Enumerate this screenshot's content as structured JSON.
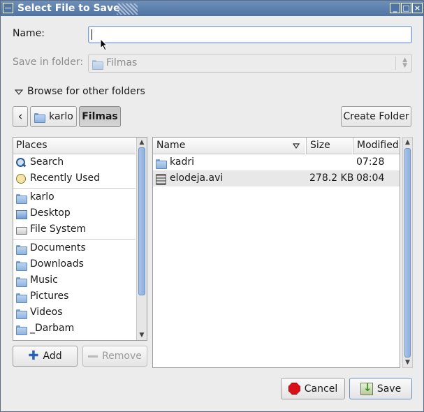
{
  "window": {
    "title": "Select File to Save",
    "controls": [
      "_",
      "□",
      "×"
    ]
  },
  "form": {
    "name_label": "Name:",
    "name_value": "",
    "save_in_label": "Save in folder:",
    "save_in_value": "Filmas",
    "browse_label": "Browse for other folders"
  },
  "path_bar": {
    "back_glyph": "‹",
    "segments": [
      {
        "label": "karlo",
        "icon": "home-icon"
      },
      {
        "label": "Filmas",
        "icon": "folder-icon",
        "active": true
      }
    ],
    "create_folder_label": "Create Folder"
  },
  "places": {
    "header": "Places",
    "groups": [
      [
        {
          "label": "Search",
          "icon": "search-icon"
        },
        {
          "label": "Recently Used",
          "icon": "recent-icon"
        }
      ],
      [
        {
          "label": "karlo",
          "icon": "home-folder-icon"
        },
        {
          "label": "Desktop",
          "icon": "desktop-icon"
        },
        {
          "label": "File System",
          "icon": "drive-icon"
        }
      ],
      [
        {
          "label": "Documents",
          "icon": "folder-icon"
        },
        {
          "label": "Downloads",
          "icon": "folder-icon"
        },
        {
          "label": "Music",
          "icon": "folder-icon"
        },
        {
          "label": "Pictures",
          "icon": "folder-icon"
        },
        {
          "label": "Videos",
          "icon": "folder-icon"
        },
        {
          "label": "_Darbam",
          "icon": "folder-icon"
        }
      ]
    ],
    "add_label": "Add",
    "remove_label": "Remove"
  },
  "files": {
    "columns": {
      "name": "Name",
      "size": "Size",
      "modified": "Modified"
    },
    "rows": [
      {
        "name": "kadri",
        "size": "",
        "modified": "07:28",
        "icon": "folder-icon"
      },
      {
        "name": "elodeja.avi",
        "size": "278.2 KB",
        "modified": "08:04",
        "icon": "video-file-icon",
        "selected": true
      }
    ]
  },
  "actions": {
    "cancel_label": "Cancel",
    "save_label": "Save"
  }
}
